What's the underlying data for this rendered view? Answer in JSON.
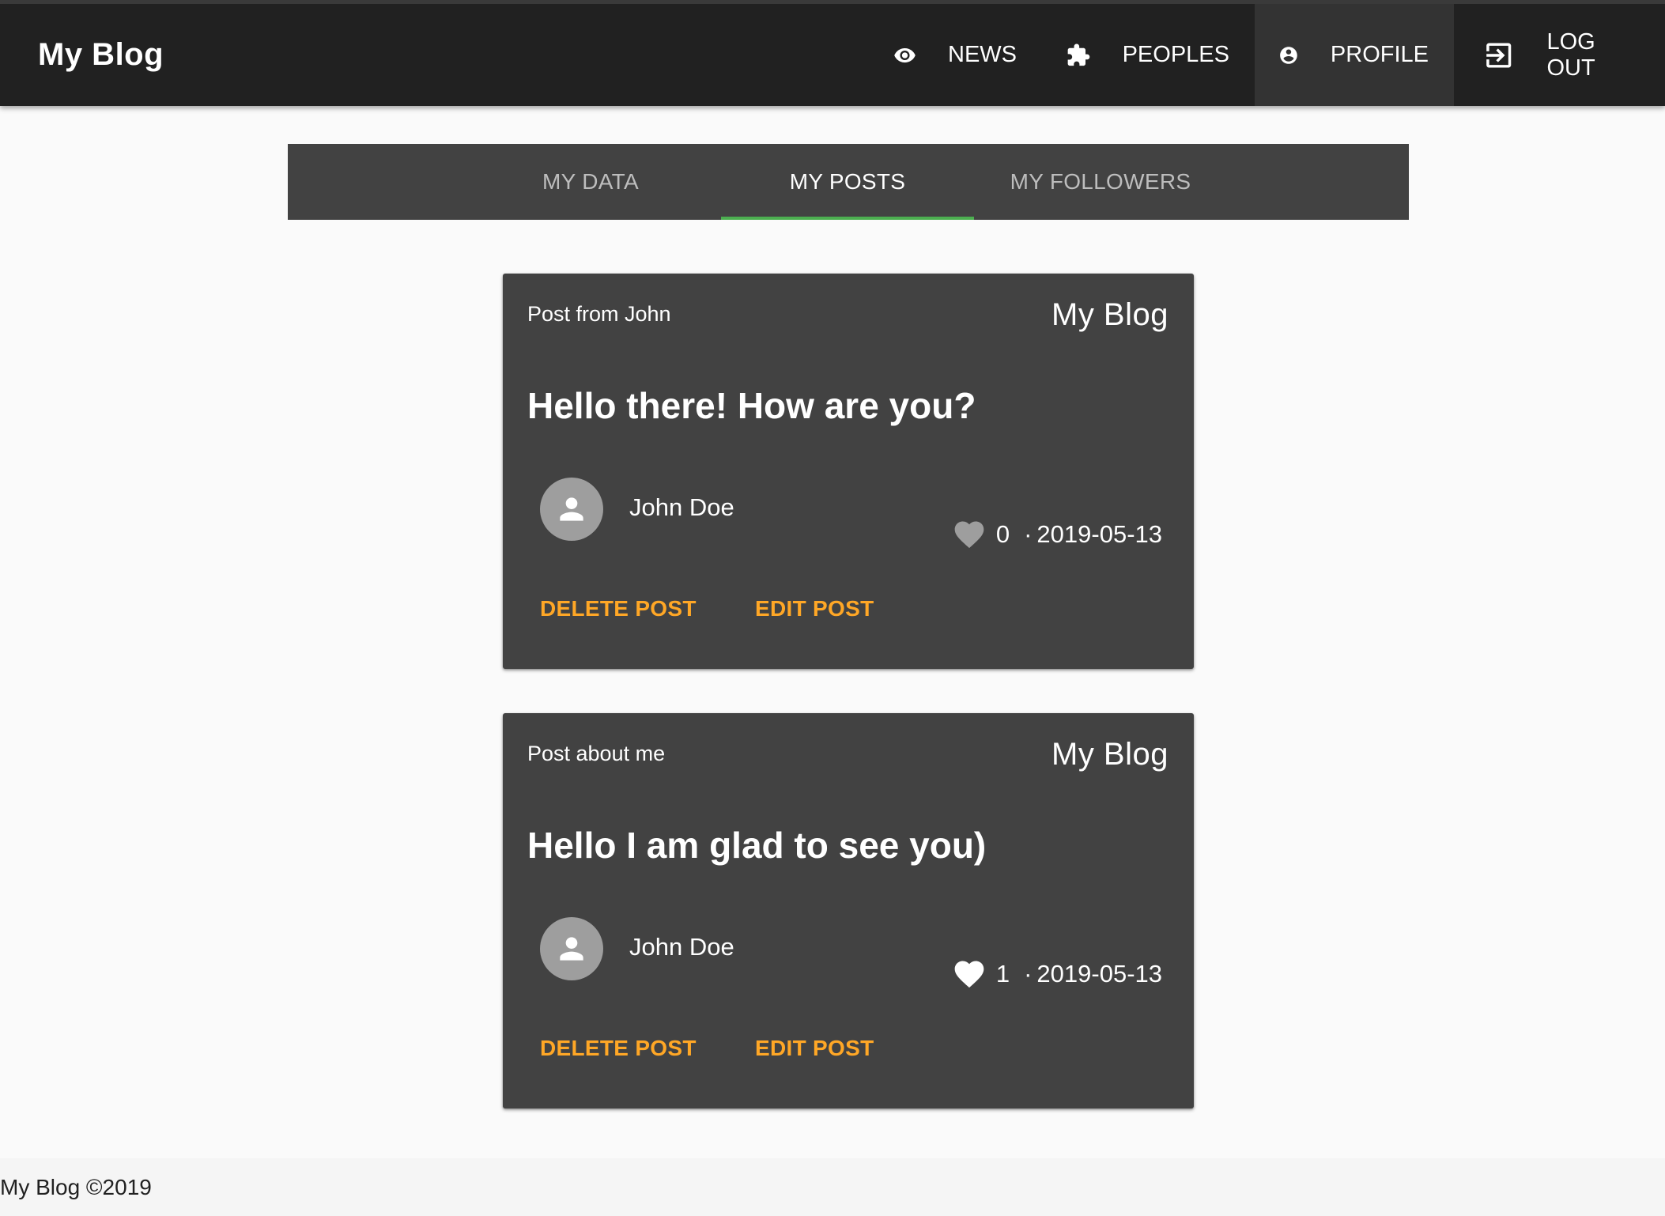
{
  "app": {
    "brand": "My Blog"
  },
  "nav": {
    "items": [
      {
        "label": "NEWS",
        "icon": "eye-icon"
      },
      {
        "label": "PEOPLES",
        "icon": "puzzle-icon"
      },
      {
        "label": "PROFILE",
        "icon": "account-circle-icon",
        "active": true
      },
      {
        "label": "LOG OUT",
        "icon": "logout-icon"
      }
    ]
  },
  "tabs": {
    "items": [
      {
        "label": "MY DATA"
      },
      {
        "label": "MY POSTS",
        "active": true
      },
      {
        "label": "MY FOLLOWERS"
      }
    ],
    "indicator_color": "#4caf50"
  },
  "posts": [
    {
      "subtitle": "Post from John",
      "brand": "My Blog",
      "title": "Hello there! How are you?",
      "author": "John Doe",
      "likes": "0",
      "liked": false,
      "separator": "·",
      "date": "2019-05-13",
      "delete_label": "DELETE POST",
      "edit_label": "EDIT POST"
    },
    {
      "subtitle": "Post about me",
      "brand": "My Blog",
      "title": "Hello I am glad to see you)",
      "author": "John Doe",
      "likes": "1",
      "liked": true,
      "separator": "·",
      "date": "2019-05-13",
      "delete_label": "DELETE POST",
      "edit_label": "EDIT POST"
    }
  ],
  "colors": {
    "topbar": "#212121",
    "card": "#424242",
    "action": "#ffa726",
    "heart_unliked": "#9e9e9e",
    "heart_liked": "#ffffff"
  },
  "footer": {
    "text": "My Blog ©2019"
  }
}
